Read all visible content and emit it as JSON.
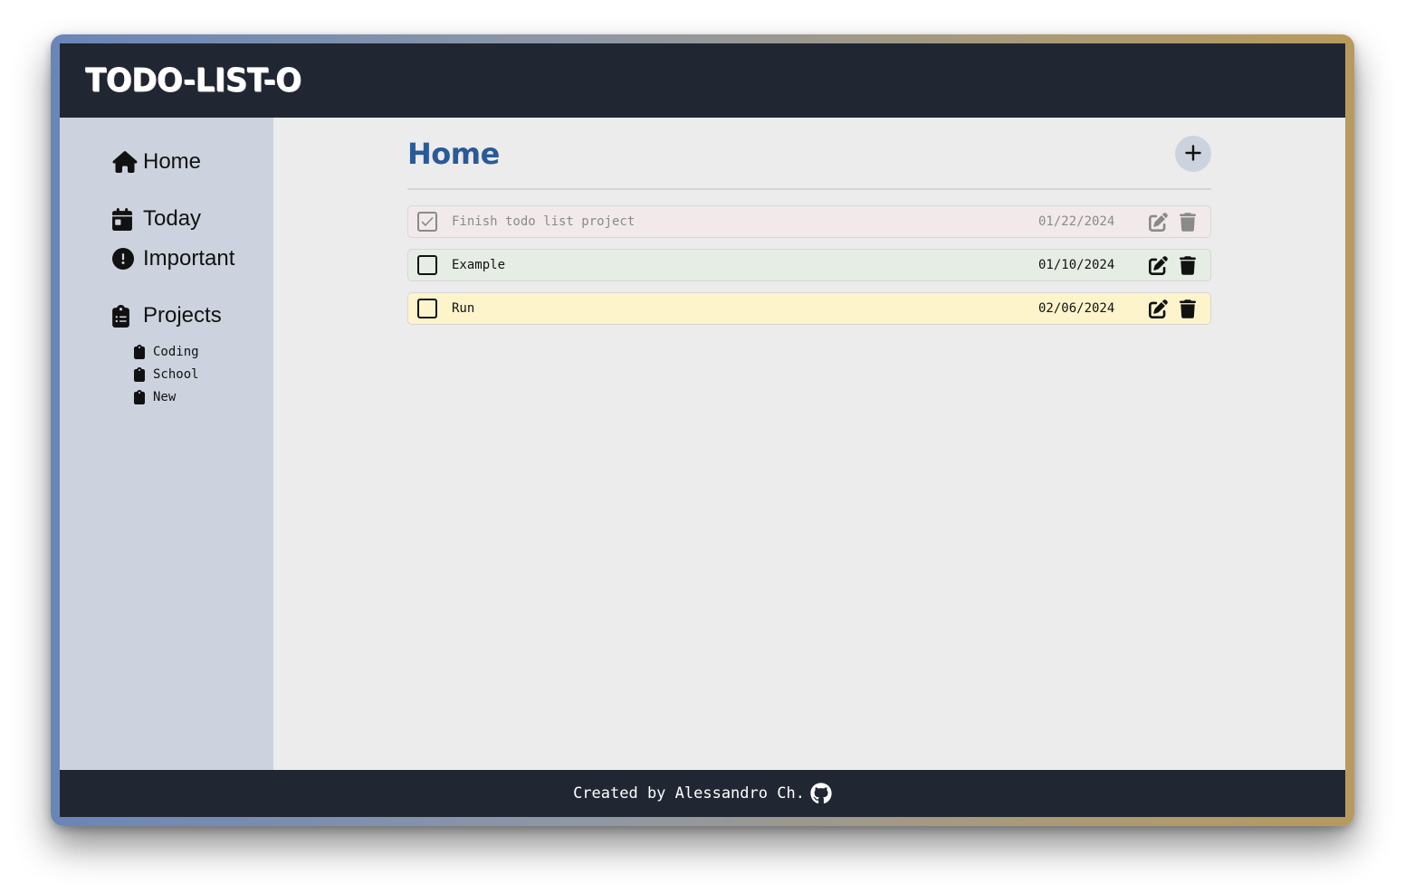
{
  "app": {
    "title": "TODO-LIST-O"
  },
  "sidebar": {
    "nav": [
      {
        "label": "Home",
        "icon": "home-icon"
      },
      {
        "label": "Today",
        "icon": "calendar-icon"
      },
      {
        "label": "Important",
        "icon": "exclamation-circle-icon"
      }
    ],
    "projects_label": "Projects",
    "projects_icon": "clipboard-list-icon",
    "projects": [
      {
        "label": "Coding",
        "icon": "clipboard-icon"
      },
      {
        "label": "School",
        "icon": "clipboard-icon"
      },
      {
        "label": "New",
        "icon": "clipboard-icon"
      }
    ]
  },
  "main": {
    "title": "Home",
    "add_icon": "plus-icon",
    "tasks": [
      {
        "title": "Finish todo list project",
        "date": "01/22/2024",
        "completed": true,
        "color": "#f2eaea"
      },
      {
        "title": "Example",
        "date": "01/10/2024",
        "completed": false,
        "color": "#e6ede4"
      },
      {
        "title": "Run",
        "date": "02/06/2024",
        "completed": false,
        "color": "#fdf4cc"
      }
    ]
  },
  "footer": {
    "text": "Created by Alessandro Ch.",
    "icon": "github-icon"
  },
  "colors": {
    "header_bg": "#212732",
    "sidebar_bg": "#ccd3de",
    "content_bg": "#ececed",
    "title_accent": "#2a5a98"
  }
}
